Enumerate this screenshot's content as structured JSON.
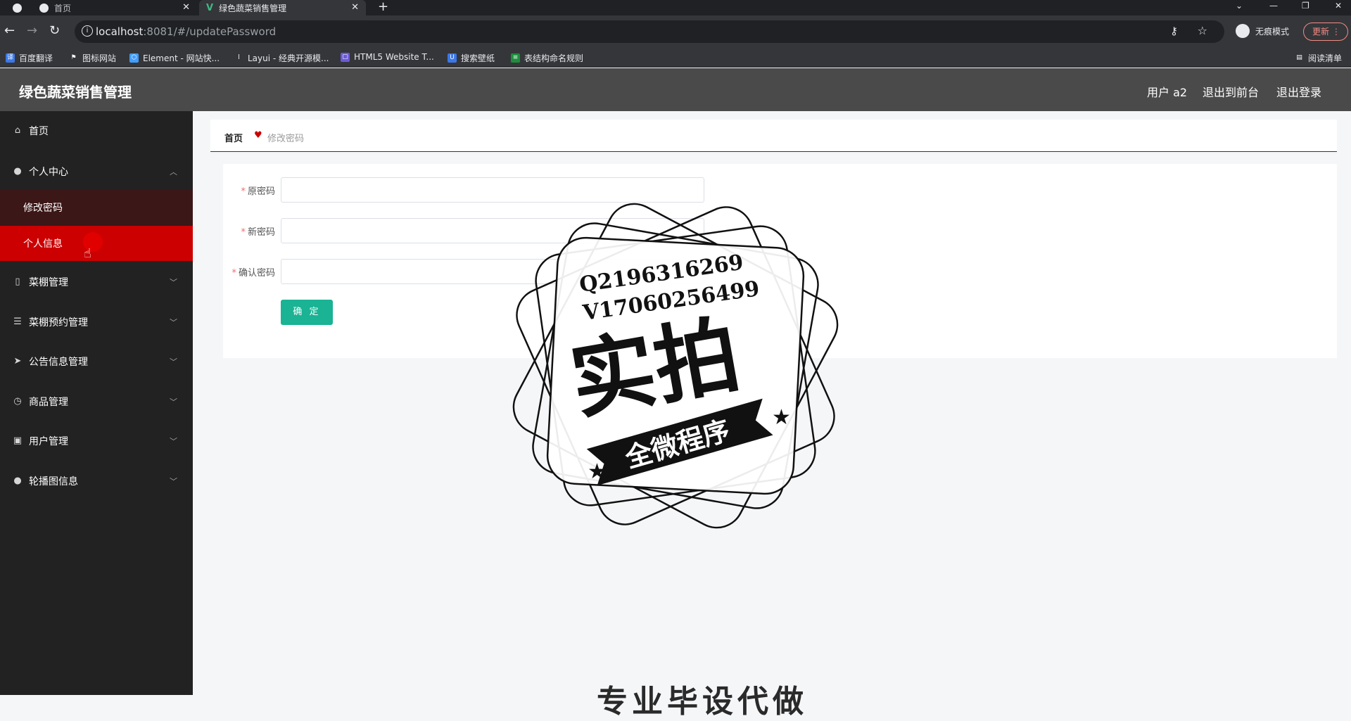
{
  "browser": {
    "tabs": [
      {
        "label": "首页"
      },
      {
        "label": "绿色蔬菜销售管理"
      }
    ],
    "url_host": "localhost",
    "url_rest": ":8081/#/updatePassword",
    "incognito_label": "无痕模式",
    "update_label": "更新",
    "bookmarks": [
      "百度翻译",
      "图标网站",
      "Element - 网站快...",
      "Layui - 经典开源模...",
      "HTML5 Website T...",
      "搜索壁纸",
      "表结构命名规则"
    ],
    "reading_list": "阅读清单"
  },
  "header": {
    "title": "绿色蔬菜销售管理",
    "user": "用户 a2",
    "back_front": "退出到前台",
    "logout": "退出登录"
  },
  "sidebar": {
    "items": [
      {
        "label": "首页",
        "icon": "home-icon"
      },
      {
        "label": "个人中心",
        "icon": "user-icon",
        "expanded": true,
        "children": [
          {
            "label": "修改密码"
          },
          {
            "label": "个人信息"
          }
        ]
      },
      {
        "label": "菜棚管理",
        "icon": "phone-icon"
      },
      {
        "label": "菜棚预约管理",
        "icon": "sliders-icon"
      },
      {
        "label": "公告信息管理",
        "icon": "send-icon"
      },
      {
        "label": "商品管理",
        "icon": "clock-icon"
      },
      {
        "label": "用户管理",
        "icon": "camera-icon"
      },
      {
        "label": "轮播图信息",
        "icon": "person-icon"
      }
    ]
  },
  "breadcrumb": {
    "home": "首页",
    "current": "修改密码"
  },
  "form": {
    "old_password_label": "原密码",
    "new_password_label": "新密码",
    "confirm_password_label": "确认密码",
    "required_mark": "*",
    "submit_label": "确 定"
  },
  "watermark": {
    "line1": "Q2196316269",
    "line2": "V17060256499",
    "big": "实拍",
    "ribbon": "全微程序"
  },
  "bottom_text": "专业毕设代做",
  "colors": {
    "accent": "#cc0000",
    "button": "#1ab394",
    "header": "#4a4a4a",
    "sidebar": "#222222"
  }
}
